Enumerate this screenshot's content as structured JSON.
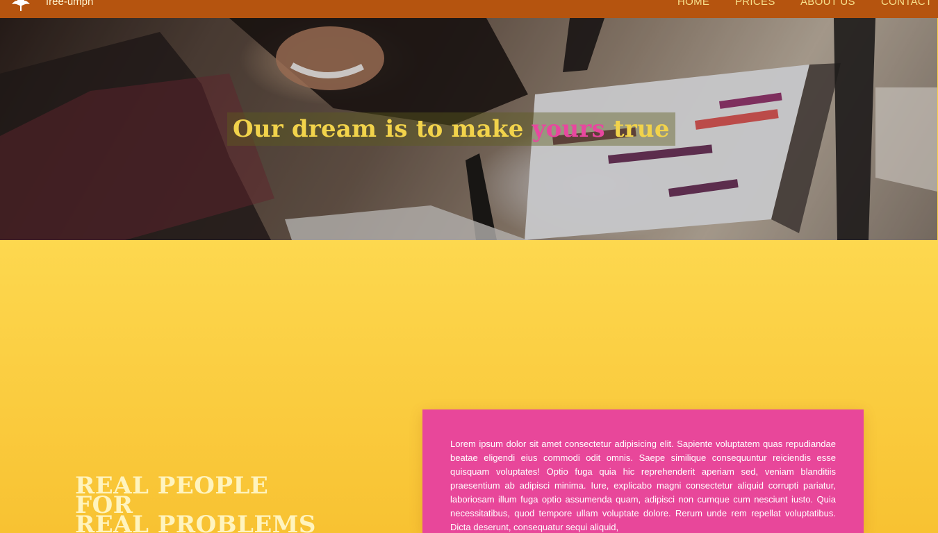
{
  "navbar": {
    "brand": "free-umph",
    "links": [
      "HOME",
      "PRICES",
      "ABOUT US",
      "CONTACT"
    ],
    "background": "#b5540f",
    "icons": {
      "logo": "tree-icon"
    }
  },
  "hero": {
    "headline_before": "Our dream is to make",
    "headline_highlight": "yours",
    "headline_after": "true",
    "headline_color": "#f2d34b",
    "highlight_color": "#e8479f",
    "image_description": "person smiling while writing near a laptop"
  },
  "feature": {
    "heading_lines": [
      "REAL PEOPLE",
      "FOR",
      "REAL PROBLEMS"
    ],
    "body": "Lorem ipsum dolor sit amet consectetur adipisicing elit. Sapiente voluptatem quas repudiandae beatae eligendi eius commodi odit omnis. Saepe similique consequuntur reiciendis esse quisquam voluptates! Optio fuga quia hic reprehenderit aperiam sed, veniam blanditiis praesentium ab adipisci minima. Iure, explicabo magni consectetur aliquid corrupti pariatur, laboriosam illum fuga optio assumenda quam, adipisci non cumque cum nesciunt iusto. Quia necessitatibus, quod tempore ullam voluptate dolore. Rerum unde rem repellat voluptatibus. Dicta deserunt, consequatur sequi aliquid,",
    "section_color": "#fcd04a",
    "card_color": "#e8479a"
  }
}
